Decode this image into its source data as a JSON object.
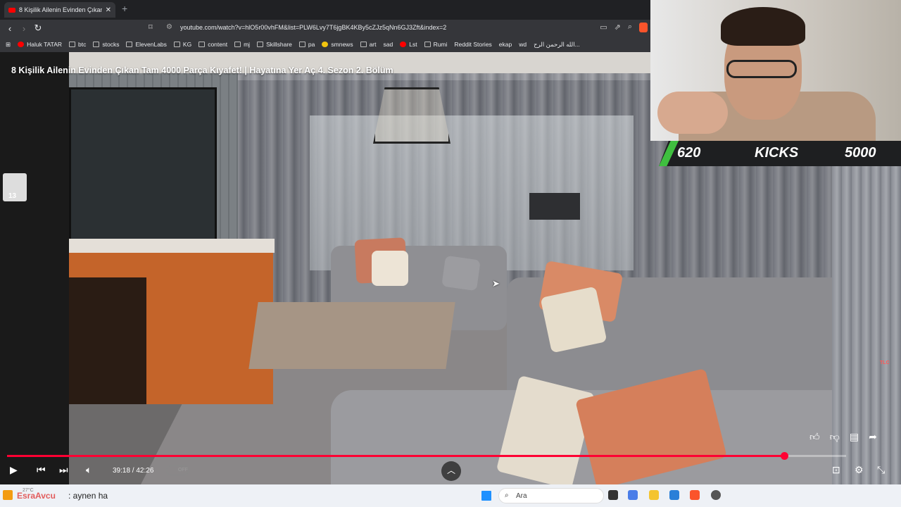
{
  "browser": {
    "tab_title": "8 Kişilik Ailenin Evinden Çıkan",
    "url": "youtube.com/watch?v=hlO5r00vhFM&list=PLW6Lvy7T6jgBK4KBy5cZJz5qNn6GJ3Zft&index=2"
  },
  "bookmarks": [
    "Haluk TATAR",
    "btc",
    "stocks",
    "ElevenLabs",
    "KG",
    "content",
    "mj",
    "Skillshare",
    "pa",
    "smnews",
    "art",
    "sad",
    "Lst",
    "Rumi",
    "Reddit Stories",
    "ekap",
    "wd",
    "الله الرحمن الرح..."
  ],
  "video": {
    "title": "8 Kişilik Ailenin Evinden Çıkan Tam 4000 Parça Kıyafet! | Hayatına Yer Aç 4. Sezon 2. Bölüm",
    "time": "39:18 / 42:26",
    "progress_fraction": 0.926,
    "avatar_badge": "13",
    "channel_logo": "TLC",
    "autoplay_label": "OFF"
  },
  "overlay": {
    "score_left": "620",
    "score_label": "KICKS",
    "score_right": "5000"
  },
  "chat": {
    "user": "EsraAvcu",
    "message": ": aynen ha",
    "weather": "27°C"
  },
  "taskbar": {
    "search_label": "Ara"
  }
}
